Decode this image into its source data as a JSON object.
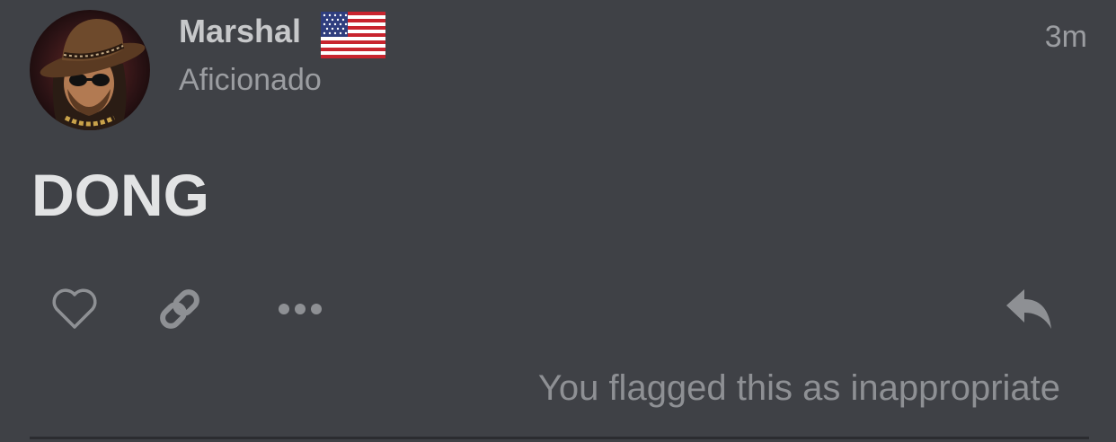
{
  "post": {
    "author": {
      "username": "Marshal",
      "title": "Aficionado",
      "avatar": "cowboy-avatar",
      "flag_icon": "us-flag-icon"
    },
    "timestamp": "3m",
    "body": "DONG",
    "actions": {
      "like_icon": "heart-icon",
      "link_icon": "link-icon",
      "more_icon": "ellipsis-icon",
      "reply_icon": "reply-icon"
    },
    "flag_notice": "You flagged this as inappropriate"
  },
  "colors": {
    "background": "#3f4146",
    "username": "#c7c8ca",
    "secondary_text": "#9b9da1",
    "body_text": "#e2e3e4",
    "icon": "#8e9094",
    "divider": "#2b2c30"
  }
}
